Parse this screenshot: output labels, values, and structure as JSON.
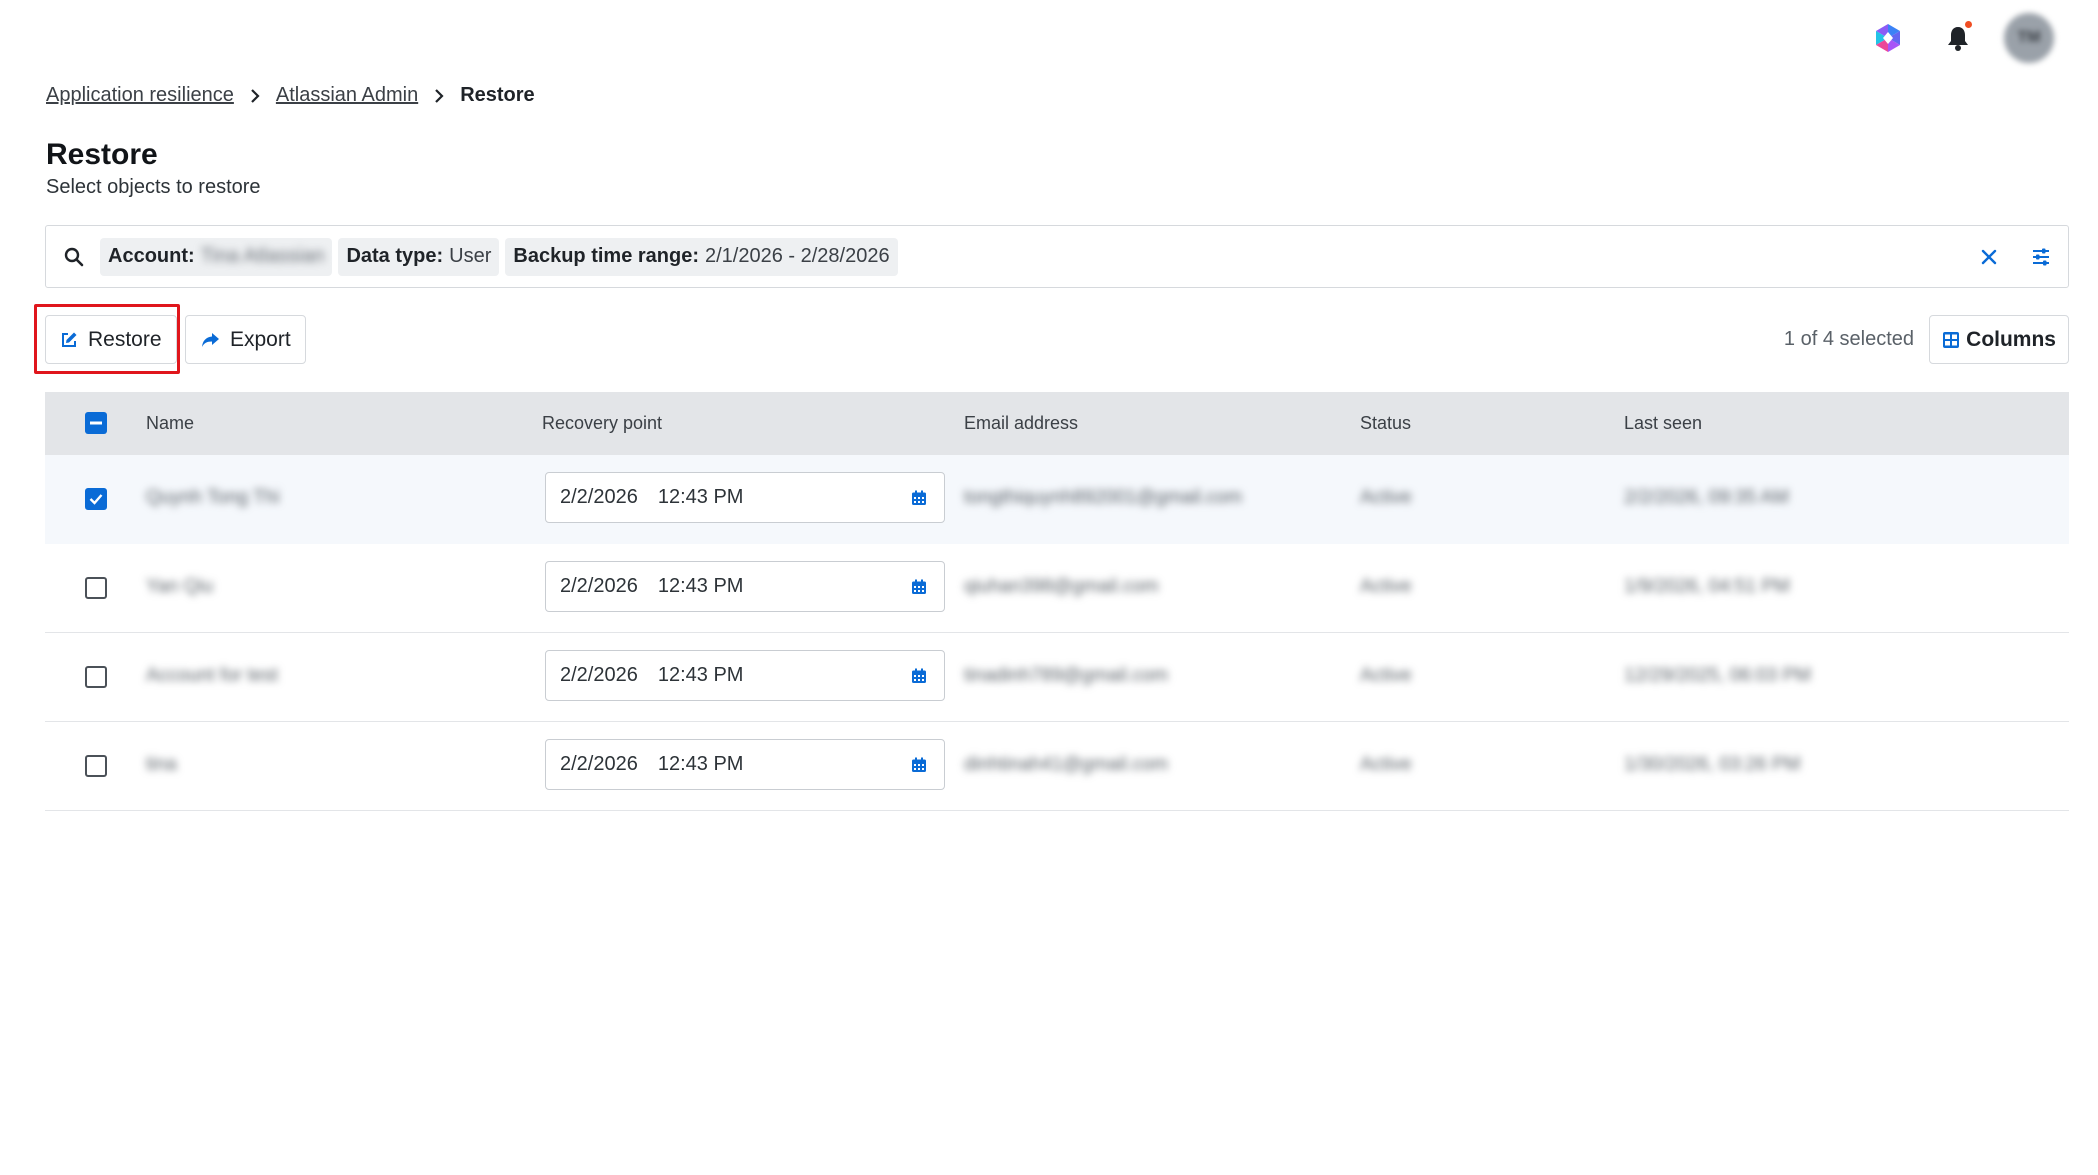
{
  "topbar": {
    "notifications_badge": true,
    "avatar_initials": "TM",
    "accent_color": "#0a6bd6",
    "badge_color": "#f04e23"
  },
  "breadcrumb": {
    "items": [
      "Application resilience",
      "Atlassian Admin"
    ],
    "current": "Restore"
  },
  "page": {
    "title": "Restore",
    "subtitle": "Select objects to restore"
  },
  "filters": {
    "account_key": "Account:",
    "account_value": "Tina Atlassian",
    "datatype_key": "Data type:",
    "datatype_value": "User",
    "range_key": "Backup time range:",
    "range_value": "2/1/2026 - 2/28/2026"
  },
  "toolbar": {
    "restore_label": "Restore",
    "export_label": "Export",
    "selection_text": "1 of 4 selected",
    "columns_label": "Columns",
    "highlight_color": "#e0161c"
  },
  "table": {
    "headers": {
      "name": "Name",
      "recovery_point": "Recovery point",
      "email": "Email address",
      "status": "Status",
      "last_seen": "Last seen"
    },
    "rows": [
      {
        "selected": true,
        "name": "Quynh Tong Thi",
        "date": "2/2/2026",
        "time": "12:43 PM",
        "email": "tongthiquynh892001@gmail.com",
        "status": "Active",
        "last_seen": "2/2/2026, 09:35 AM"
      },
      {
        "selected": false,
        "name": "Yan Qiu",
        "date": "2/2/2026",
        "time": "12:43 PM",
        "email": "qiuhan398@gmail.com",
        "status": "Active",
        "last_seen": "1/9/2026, 04:51 PM"
      },
      {
        "selected": false,
        "name": "Account for test",
        "date": "2/2/2026",
        "time": "12:43 PM",
        "email": "tinadinh789@gmail.com",
        "status": "Active",
        "last_seen": "12/29/2025, 06:03 PM"
      },
      {
        "selected": false,
        "name": "tina",
        "date": "2/2/2026",
        "time": "12:43 PM",
        "email": "dinhtinah41@gmail.com",
        "status": "Active",
        "last_seen": "1/30/2026, 03:26 PM"
      }
    ]
  }
}
